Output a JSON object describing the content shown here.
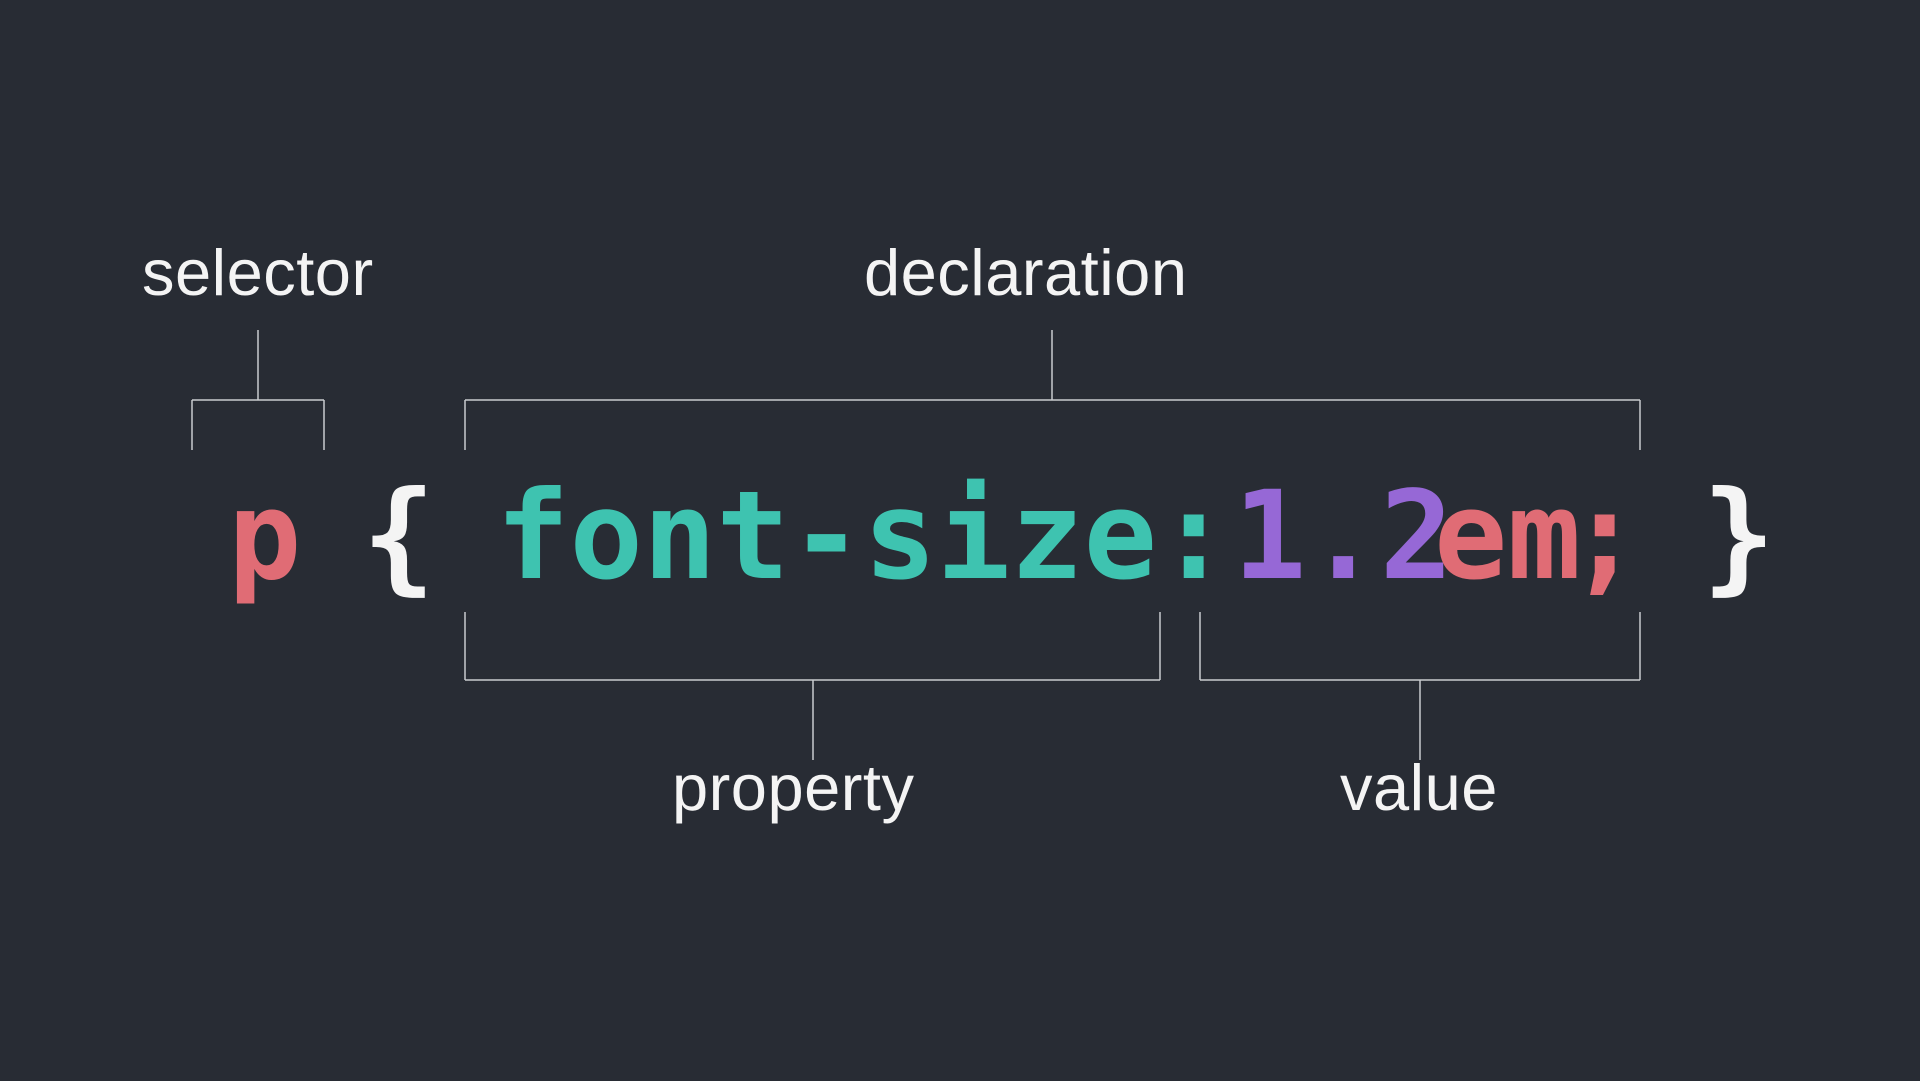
{
  "labels": {
    "selector": "selector",
    "declaration": "declaration",
    "property": "property",
    "value": "value"
  },
  "code": {
    "selector": "p",
    "open_brace": "{",
    "property": "font-size:",
    "value_number": "1.2",
    "value_unit": "em",
    "semicolon": ";",
    "close_brace": "}"
  }
}
